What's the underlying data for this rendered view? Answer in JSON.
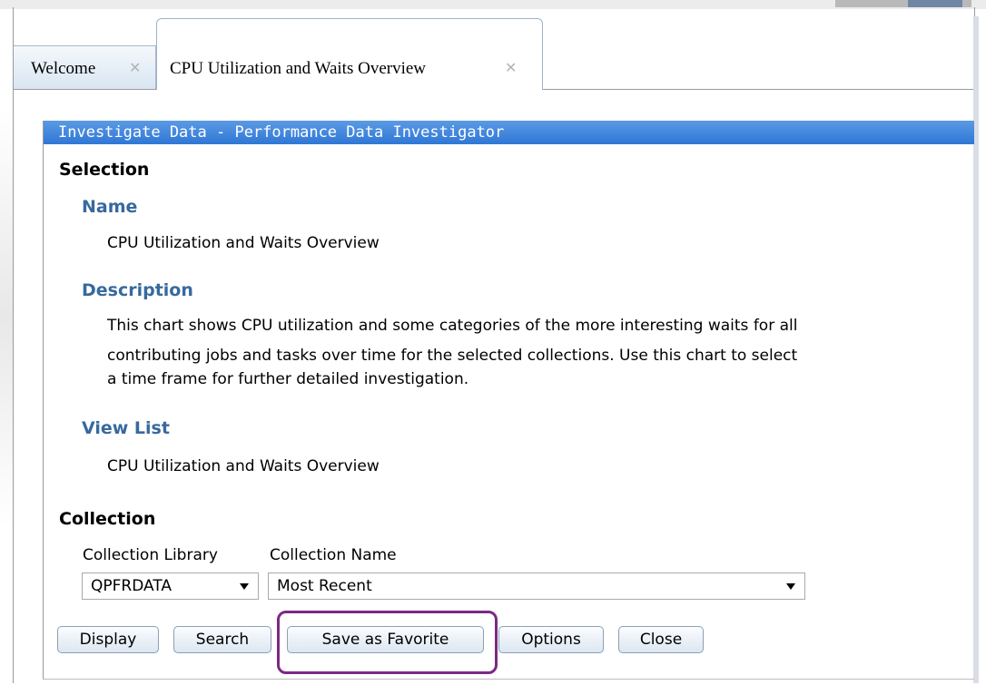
{
  "tabs": [
    {
      "label": "Welcome",
      "close": "✕"
    },
    {
      "label": "CPU Utilization and Waits Overview",
      "close": "✕"
    }
  ],
  "panel": {
    "title": "Investigate Data - Performance Data Investigator",
    "selection_heading": "Selection",
    "name_heading": "Name",
    "name_value": "CPU Utilization and Waits Overview",
    "description_heading": "Description",
    "description_lines": [
      "This chart shows CPU utilization and some categories of the more interesting waits for all",
      "contributing jobs and tasks over time for the selected collections. Use this chart to select",
      "a time frame for further detailed investigation."
    ],
    "viewlist_heading": "View List",
    "viewlist_value": "CPU Utilization and Waits Overview",
    "collection_heading": "Collection",
    "collection_library_label": "Collection Library",
    "collection_library_value": "QPFRDATA",
    "collection_name_label": "Collection Name",
    "collection_name_value": "Most Recent"
  },
  "buttons": {
    "display": "Display",
    "search": "Search",
    "save_favorite": "Save as Favorite",
    "options": "Options",
    "close": "Close"
  },
  "colors": {
    "title_bar": "#2f77d6",
    "subheading": "#37699e",
    "highlight": "#7a2a84"
  }
}
